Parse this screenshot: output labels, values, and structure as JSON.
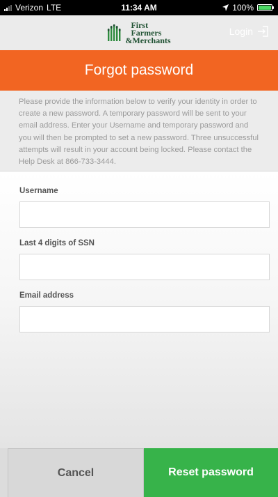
{
  "status_bar": {
    "carrier": "Verizon",
    "network": "LTE",
    "time": "11:34 AM",
    "battery": "100%",
    "battery_level": 1.0
  },
  "topbar": {
    "logo_lines": [
      "First",
      "Farmers",
      "&Merchants"
    ],
    "login_label": "Login"
  },
  "header": {
    "title": "Forgot password"
  },
  "intro": {
    "text": "Please provide the information below to verify your identity in order to create a new password.  A temporary password will be sent to your email address. Enter your Username and temporary password and you will then be prompted to set a new password. Three unsuccessful attempts will result in your account being locked.  Please contact the Help Desk at 866-733-3444."
  },
  "form": {
    "username": {
      "label": "Username",
      "value": ""
    },
    "ssn": {
      "label": "Last 4 digits of SSN",
      "value": ""
    },
    "email": {
      "label": "Email address",
      "value": ""
    }
  },
  "buttons": {
    "cancel": "Cancel",
    "reset": "Reset password"
  },
  "colors": {
    "brand_orange": "#f26522",
    "brand_green": "#37b34a",
    "logo_green": "#1f5132"
  },
  "icons": {
    "login": "login-arrow-icon",
    "logo": "wheat-logo-icon"
  }
}
